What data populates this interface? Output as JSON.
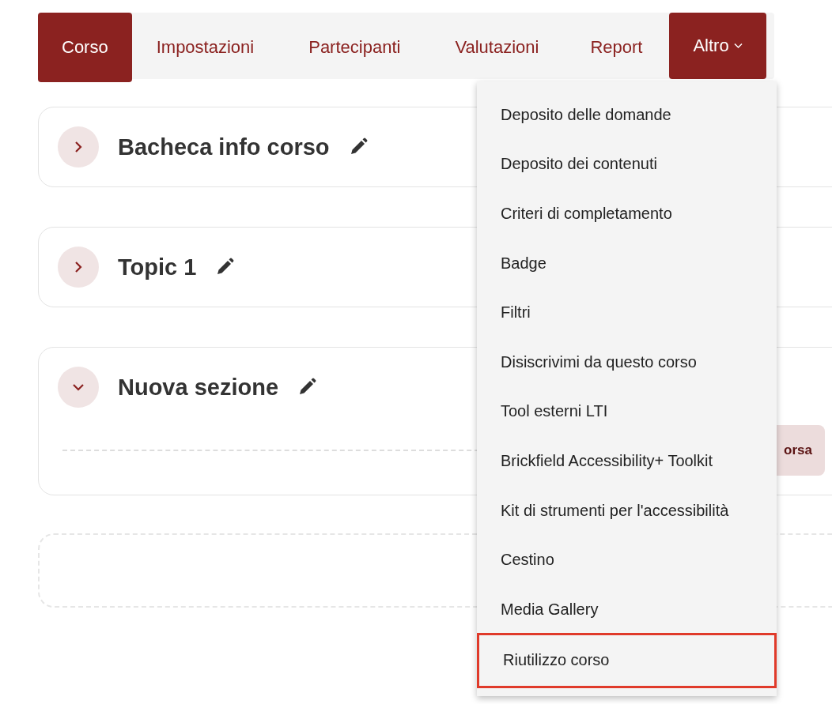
{
  "tabs": [
    {
      "label": "Corso",
      "selected": true,
      "kind": "tab"
    },
    {
      "label": "Impostazioni",
      "selected": false,
      "kind": "tab"
    },
    {
      "label": "Partecipanti",
      "selected": false,
      "kind": "tab"
    },
    {
      "label": "Valutazioni",
      "selected": false,
      "kind": "tab"
    },
    {
      "label": "Report",
      "selected": false,
      "kind": "tab"
    },
    {
      "label": "Altro",
      "selected": true,
      "kind": "dropdown"
    }
  ],
  "sections": [
    {
      "title": "Bacheca info corso",
      "expanded": false
    },
    {
      "title": "Topic 1",
      "expanded": false
    },
    {
      "title": "Nuova sezione",
      "expanded": true,
      "button": "orsa"
    }
  ],
  "menu": {
    "items": [
      {
        "label": "Deposito delle domande",
        "highlighted": false
      },
      {
        "label": "Deposito dei contenuti",
        "highlighted": false
      },
      {
        "label": "Criteri di completamento",
        "highlighted": false
      },
      {
        "label": "Badge",
        "highlighted": false
      },
      {
        "label": "Filtri",
        "highlighted": false
      },
      {
        "label": "Disiscrivimi da questo corso",
        "highlighted": false
      },
      {
        "label": "Tool esterni LTI",
        "highlighted": false
      },
      {
        "label": "Brickfield Accessibility+ Toolkit",
        "highlighted": false
      },
      {
        "label": "Kit di strumenti per l'accessibilità",
        "highlighted": false
      },
      {
        "label": "Cestino",
        "highlighted": false
      },
      {
        "label": "Media Gallery",
        "highlighted": false
      },
      {
        "label": "Riutilizzo corso",
        "highlighted": true
      }
    ]
  }
}
